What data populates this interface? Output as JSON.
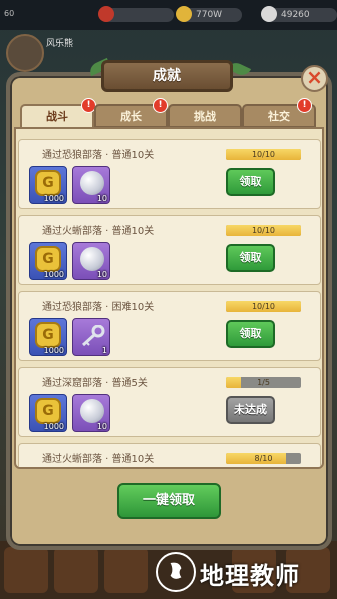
{
  "hud": {
    "level": "60",
    "res1_value": "",
    "gold_value": "770W",
    "diamond_value": "49260",
    "player_name": "风乐熊"
  },
  "dialog": {
    "title": "成就",
    "close_label": "×"
  },
  "tabs": [
    {
      "label": "战斗",
      "active": true,
      "badge": "!"
    },
    {
      "label": "成长",
      "active": false,
      "badge": "!"
    },
    {
      "label": "挑战",
      "active": false,
      "badge": ""
    },
    {
      "label": "社交",
      "active": false,
      "badge": "!"
    }
  ],
  "achievements": [
    {
      "title": "通过恐狼部落 · 普通10关",
      "progress_text": "10/10",
      "progress": 1.0,
      "rewards": [
        {
          "type": "gold-coin",
          "qty": "1000"
        },
        {
          "type": "orb",
          "qty": "10"
        }
      ],
      "button": "领取",
      "claimable": true
    },
    {
      "title": "通过火蜥部落 · 普通10关",
      "progress_text": "10/10",
      "progress": 1.0,
      "rewards": [
        {
          "type": "gold-coin",
          "qty": "1000"
        },
        {
          "type": "orb",
          "qty": "10"
        }
      ],
      "button": "领取",
      "claimable": true
    },
    {
      "title": "通过恐狼部落 · 困难10关",
      "progress_text": "10/10",
      "progress": 1.0,
      "rewards": [
        {
          "type": "gold-coin",
          "qty": "1000"
        },
        {
          "type": "key",
          "qty": "1"
        }
      ],
      "button": "领取",
      "claimable": true
    },
    {
      "title": "通过深窟部落 · 普通5关",
      "progress_text": "1/5",
      "progress": 0.2,
      "rewards": [
        {
          "type": "gold-coin",
          "qty": "1000"
        },
        {
          "type": "orb",
          "qty": "10"
        }
      ],
      "button": "未达成",
      "claimable": false
    },
    {
      "title": "通过火蜥部落 · 普通10关",
      "progress_text": "8/10",
      "progress": 0.8,
      "rewards": [],
      "button": "",
      "claimable": false
    }
  ],
  "claim_all_label": "一键领取",
  "watermark": {
    "text": "地理教师",
    "logo_ring_text": "AMSLAREE"
  },
  "colors": {
    "claim_green": "#2f9a3a",
    "disabled_gray": "#777777",
    "progress_gold": "#e8b43a"
  }
}
